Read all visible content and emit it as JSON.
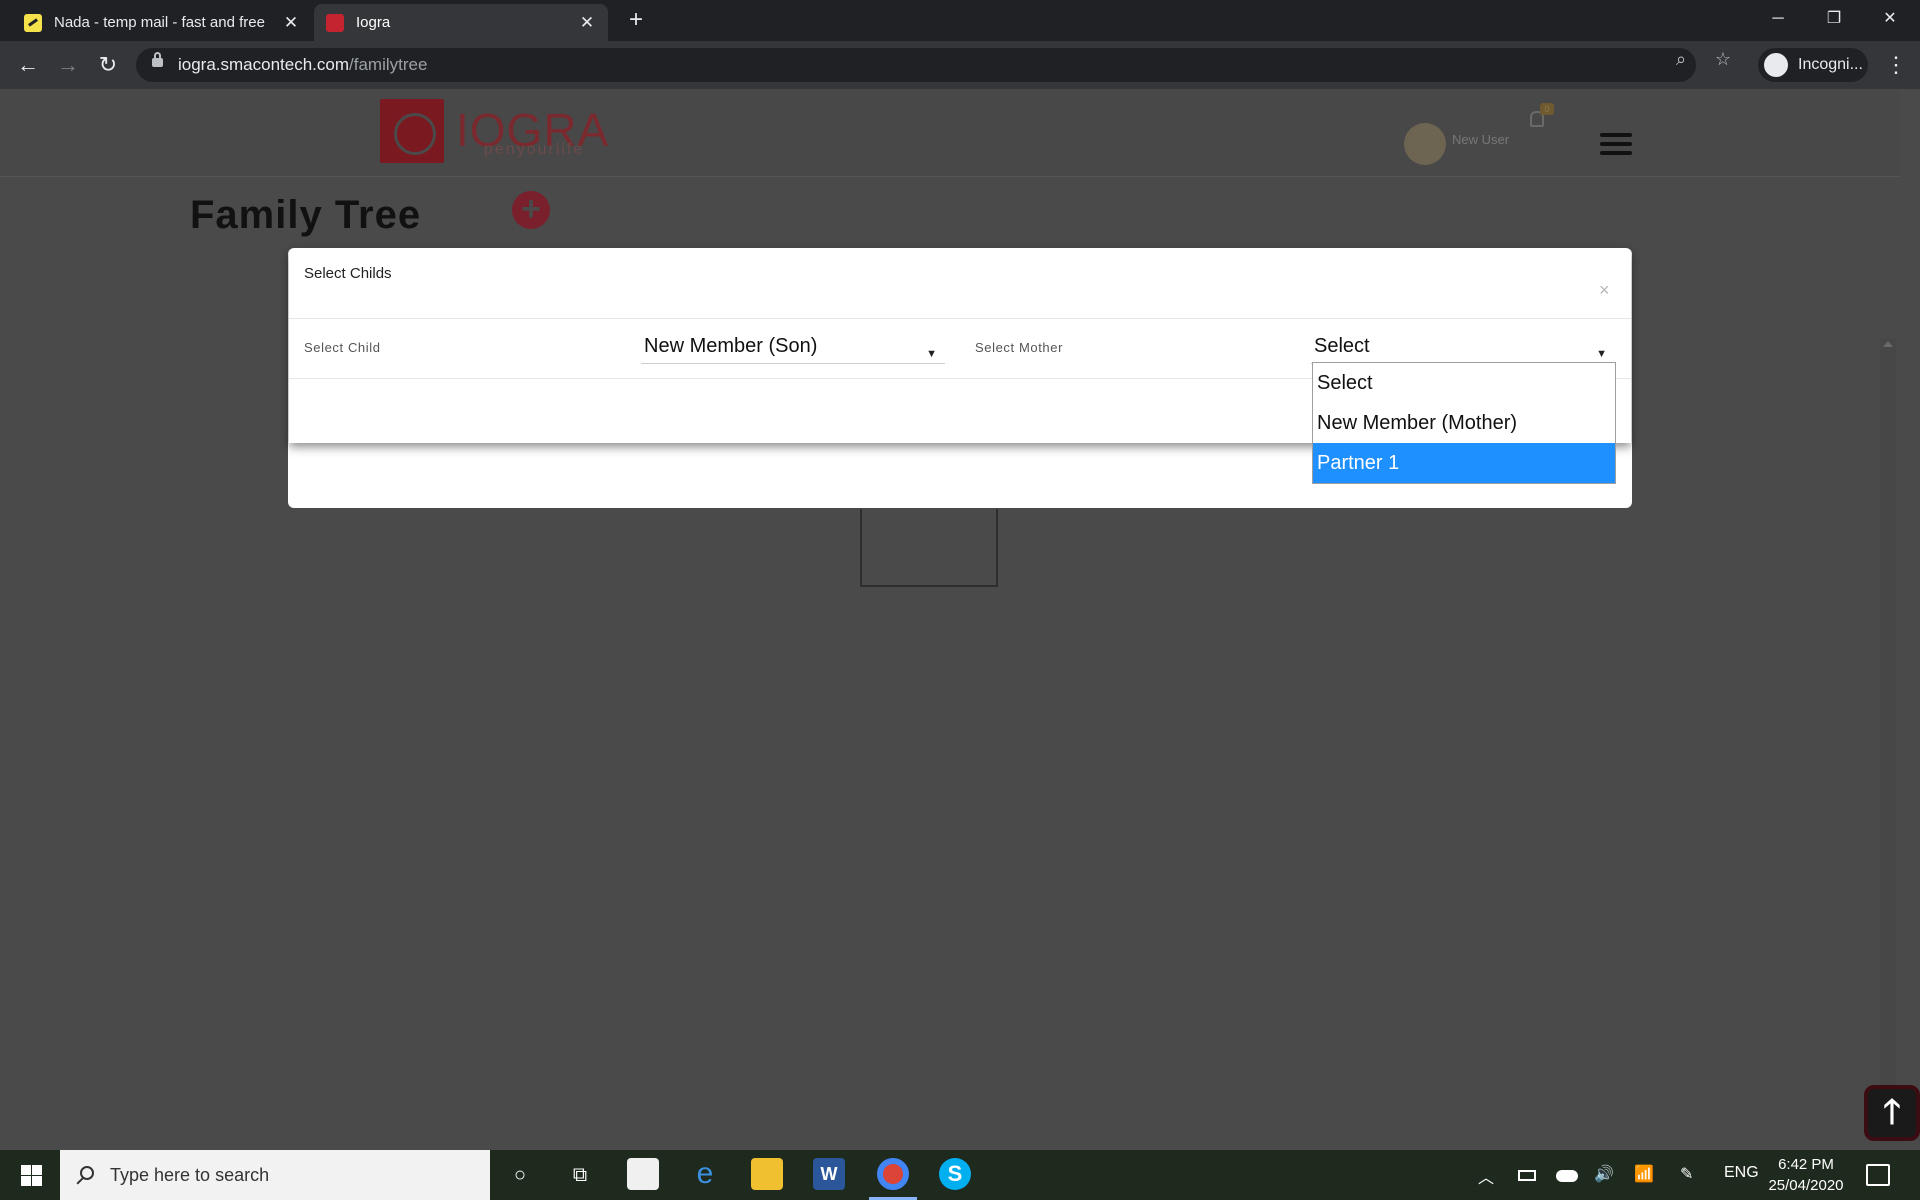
{
  "browser": {
    "tabs": [
      {
        "title": "Nada - temp mail - fast and free",
        "close": "✕"
      },
      {
        "title": "Iogra",
        "close": "✕"
      }
    ],
    "new_tab": "+",
    "window_controls": {
      "minimize": "─",
      "restore": "❐",
      "close": "✕"
    },
    "nav": {
      "back": "←",
      "forward": "→",
      "reload": "↻"
    },
    "url_host": "iogra.smacontech.com",
    "url_path": "/familytree",
    "zoom_icon": "⌕",
    "star_icon": "☆",
    "profile_label": "Incogni...",
    "menu": "⋮"
  },
  "site": {
    "logo_text": "IOGRA",
    "logo_tagline": "penyourlife",
    "user_name": "New User",
    "notification_count": "0",
    "page_title": "Family Tree",
    "add_symbol": "+",
    "scroll_top_symbol": "🡑"
  },
  "modal": {
    "title": "Select Childs",
    "close": "×",
    "child_label": "Select Child",
    "child_value": "New Member (Son)",
    "mother_label": "Select Mother",
    "mother_value": "Select",
    "arrow": "▼",
    "mother_options": [
      "Select",
      "New Member (Mother)",
      "Partner 1"
    ],
    "mother_highlighted": "Partner 1"
  },
  "taskbar": {
    "search_placeholder": "Type here to search",
    "cortana": "○",
    "task_view": "⧉",
    "word_letter": "W",
    "skype_letter": "S",
    "edge_letter": "e",
    "tray": {
      "chevron": "︿",
      "language": "ENG"
    },
    "time": "6:42 PM",
    "date": "25/04/2020"
  }
}
